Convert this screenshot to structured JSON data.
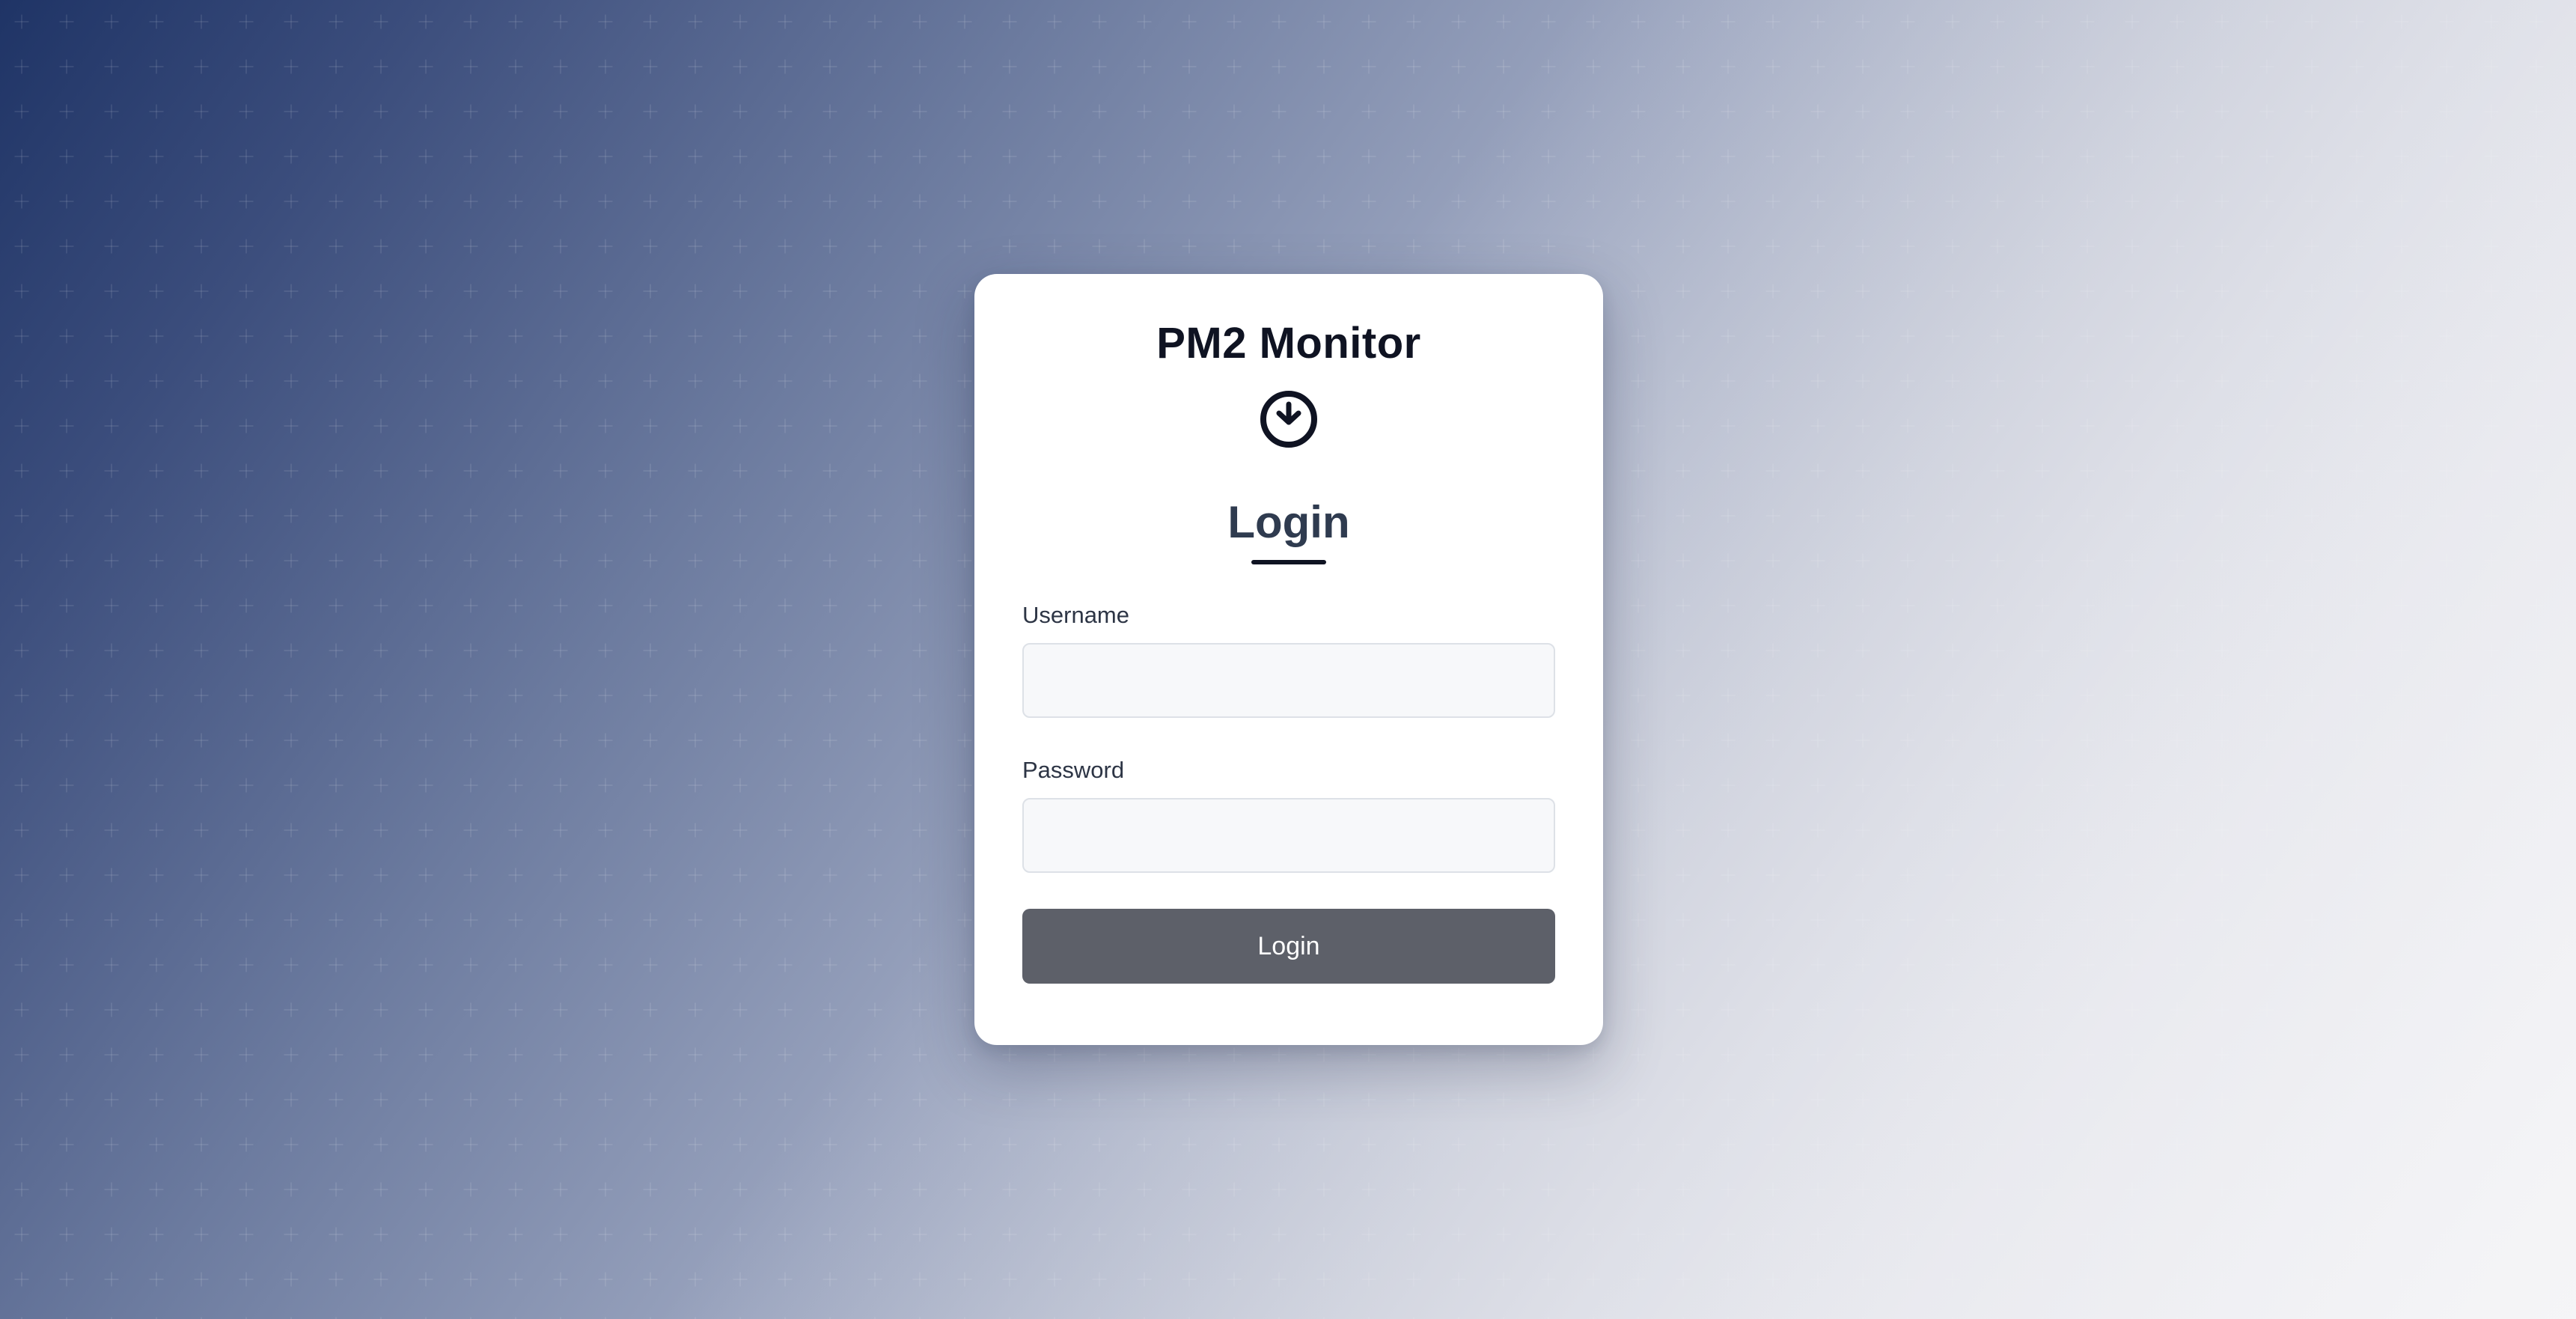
{
  "app": {
    "title": "PM2 Monitor",
    "logo_icon": "clock-download-icon"
  },
  "login_form": {
    "heading": "Login",
    "username": {
      "label": "Username",
      "value": "",
      "placeholder": ""
    },
    "password": {
      "label": "Password",
      "value": "",
      "placeholder": ""
    },
    "submit_label": "Login"
  },
  "colors": {
    "background_start": "#1f3466",
    "background_end": "#f2f2f4",
    "card": "#ffffff",
    "button": "#5d6069",
    "title_text": "#0f1322",
    "heading_text": "#2f3b4f"
  }
}
